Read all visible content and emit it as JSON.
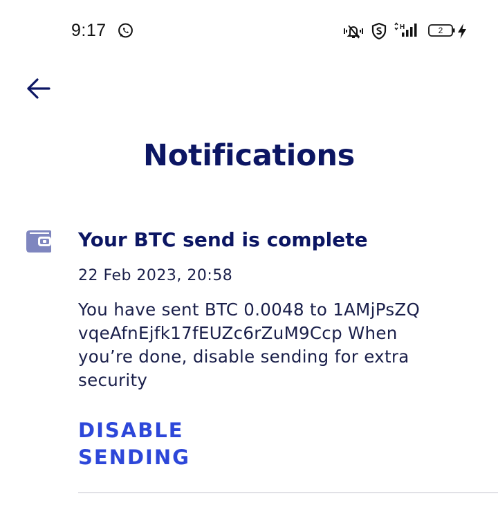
{
  "status_bar": {
    "time": "9:17",
    "battery_level": "2",
    "icons": [
      "whatsapp-icon",
      "vibrate-icon",
      "shield-s-icon",
      "signal-icon",
      "battery-icon",
      "charging-icon"
    ]
  },
  "header": {
    "back_icon": "arrow-left-icon",
    "title": "Notifications"
  },
  "notifications": [
    {
      "icon": "wallet-icon",
      "title": "Your BTC send is complete",
      "date": "22 Feb 2023, 20:58",
      "body_lines": [
        "You have sent BTC 0.0048 to 1AMjPsZQ",
        "vqeAfnEjfk17fEUZc6rZuM9Ccp When",
        "you’re done, disable sending for extra",
        "security"
      ],
      "action_lines": [
        "DISABLE",
        "SENDING"
      ]
    }
  ],
  "colors": {
    "title": "#0c1663",
    "body_text": "#1a1f4a",
    "action": "#2d47d9",
    "icon": "#7f86bf",
    "divider": "#e1e1e6"
  }
}
